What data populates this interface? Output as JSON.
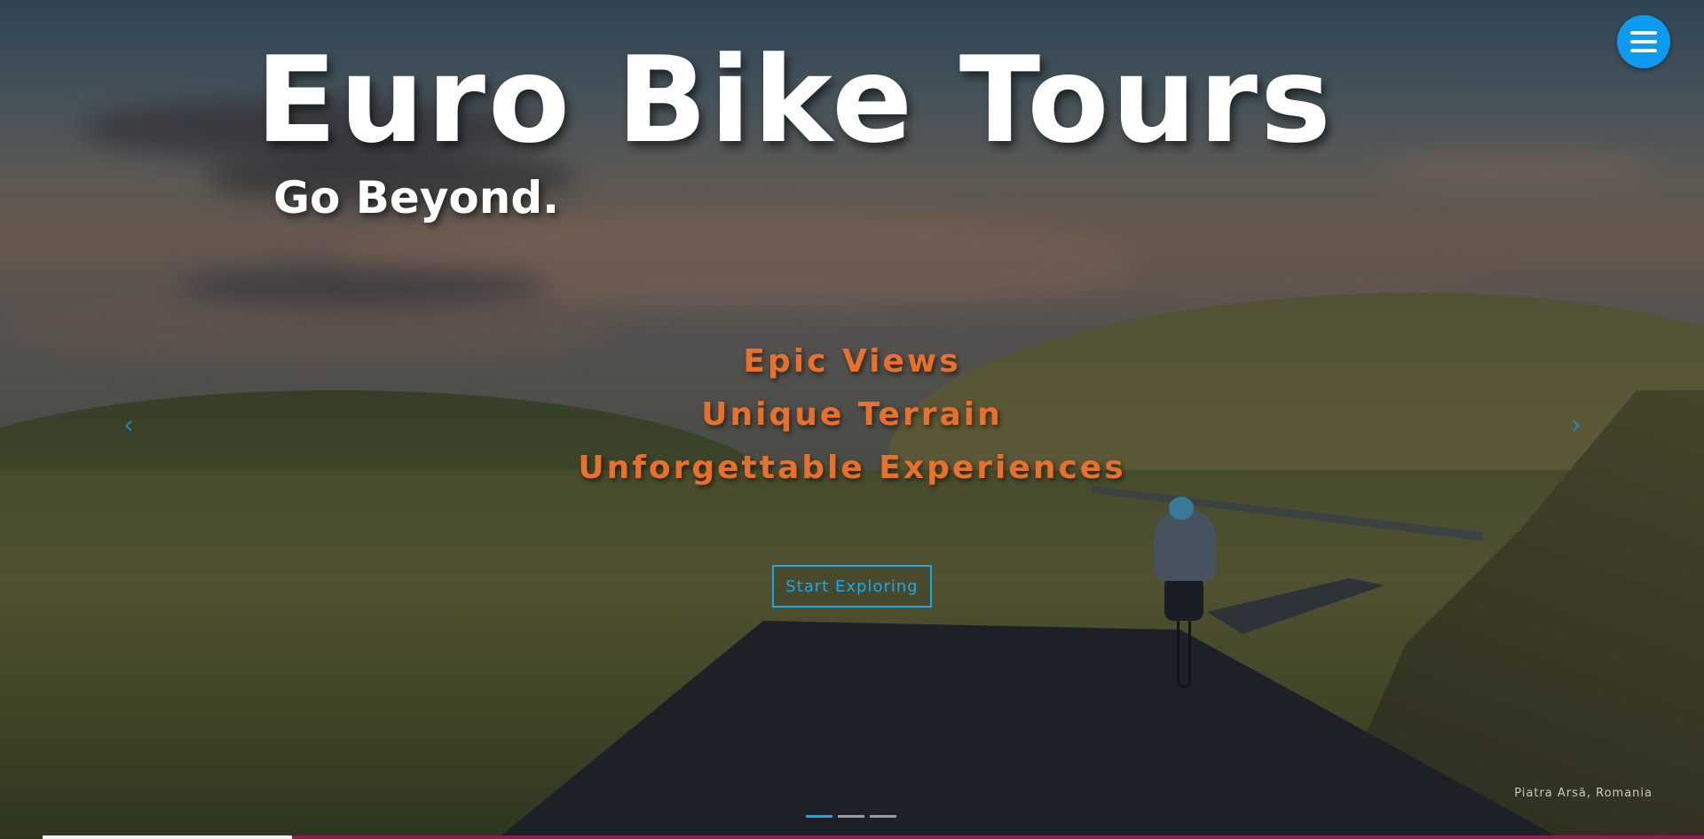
{
  "brand": {
    "title": "Euro Bike Tours",
    "tagline": "Go Beyond."
  },
  "menu": {
    "icon": "hamburger-menu-icon",
    "accent_color": "#0d9bf2"
  },
  "carousel": {
    "features": [
      "Epic Views",
      "Unique Terrain",
      "Unforgettable Experiences"
    ],
    "feature_color": "#e8702a",
    "cta_label": "Start Exploring",
    "cta_color": "#18a8f2",
    "prev_icon": "chevron-left-icon",
    "next_icon": "chevron-right-icon",
    "location": "Piatra Arsă, Romania",
    "slide_count": 3,
    "active_slide": 1,
    "progress": 0.15
  }
}
